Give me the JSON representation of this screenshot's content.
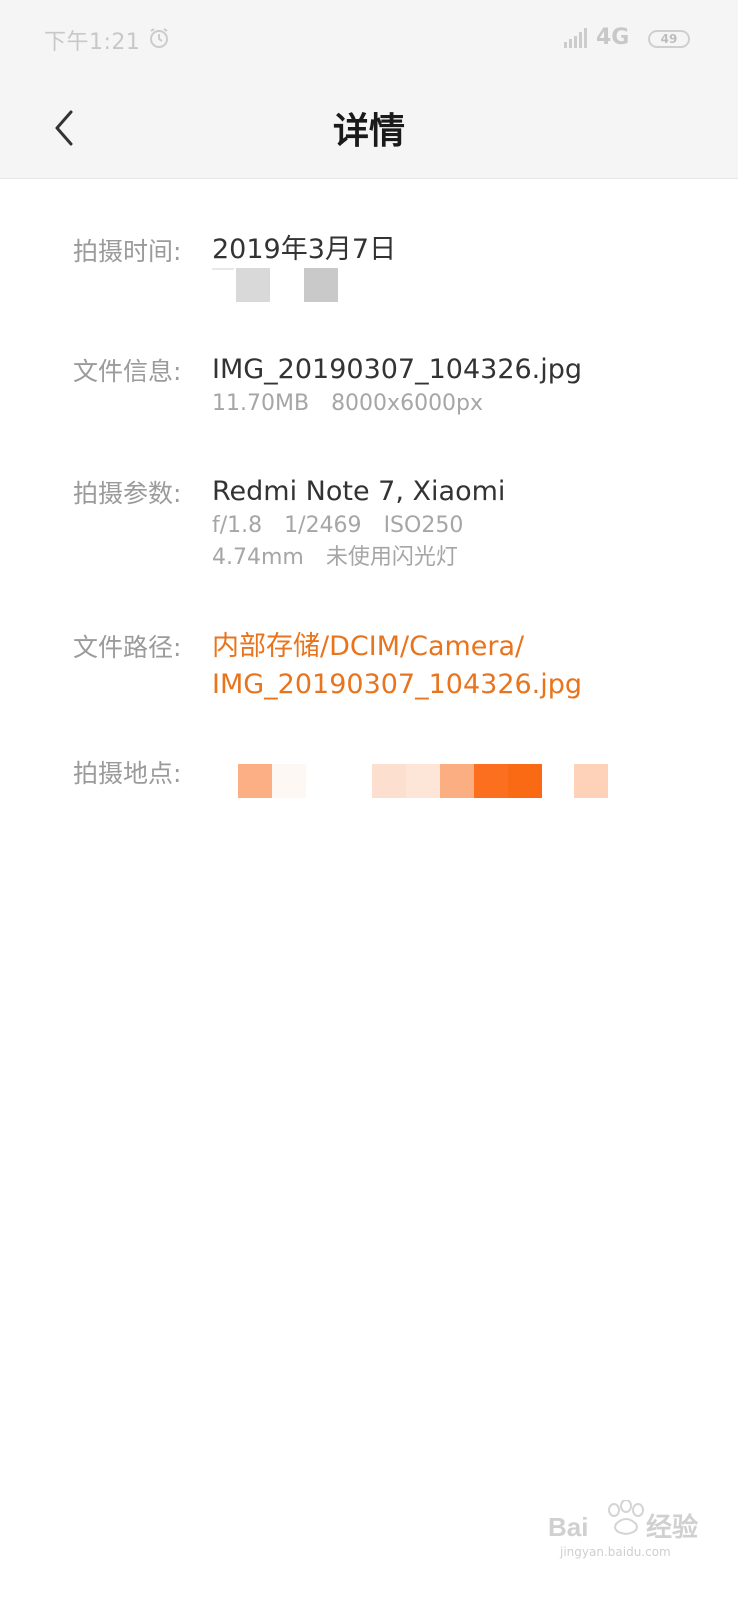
{
  "status_bar": {
    "time": "下午1:21",
    "network": "4G",
    "battery": "49"
  },
  "header": {
    "title": "详情"
  },
  "details": {
    "shoot_time": {
      "label": "拍摄时间:",
      "date": "2019年3月7日"
    },
    "file_info": {
      "label": "文件信息:",
      "name": "IMG_20190307_104326.jpg",
      "size": "11.70MB",
      "resolution": "8000x6000px"
    },
    "shoot_params": {
      "label": "拍摄参数:",
      "device": "Redmi Note 7, Xiaomi",
      "aperture": "f/1.8",
      "shutter": "1/2469",
      "iso": "ISO250",
      "focal_length": "4.74mm",
      "flash": "未使用闪光灯"
    },
    "file_path": {
      "label": "文件路径:",
      "line1": "内部存储/DCIM/Camera/",
      "line2": "IMG_20190307_104326.jpg"
    },
    "location": {
      "label": "拍摄地点:"
    }
  },
  "watermark": {
    "text": "jingyan.baidu.com"
  },
  "colors": {
    "link": "#e8741e",
    "label": "#9b9b9b",
    "value": "#333333",
    "header_bg": "#f5f5f5"
  }
}
